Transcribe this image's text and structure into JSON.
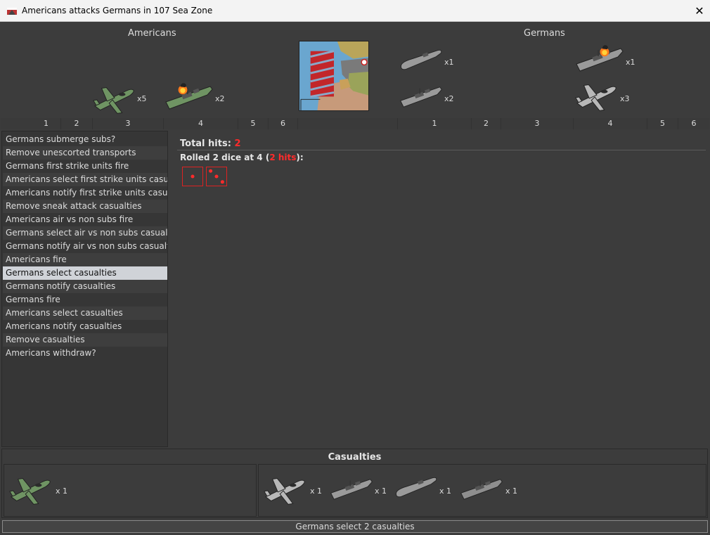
{
  "window": {
    "title": "Americans attacks Germans in 107 Sea Zone",
    "close_label": "✕"
  },
  "attacker": {
    "name": "Americans",
    "units": [
      {
        "icon": "fighter-plane-green-icon",
        "count": "x5"
      },
      {
        "icon": "damaged-battleship-green-icon",
        "count": "x2"
      }
    ],
    "dice_columns": [
      "1",
      "2",
      "3",
      "4",
      "5",
      "6"
    ]
  },
  "defender": {
    "name": "Germans",
    "units": [
      {
        "icon": "submarine-gray-icon",
        "count": "x1"
      },
      {
        "icon": "damaged-battleship-gray-icon",
        "count": "x1"
      },
      {
        "icon": "destroyer-gray-icon",
        "count": "x2"
      },
      {
        "icon": "fighter-plane-gray-icon",
        "count": "x3"
      }
    ],
    "dice_columns": [
      "1",
      "2",
      "3",
      "4",
      "5",
      "6"
    ]
  },
  "steps": [
    "Germans submerge subs?",
    "Remove unescorted transports",
    "Germans first strike units fire",
    "Americans select first strike units casualties",
    "Americans notify first strike units casualties",
    "Remove sneak attack casualties",
    "Americans air vs non subs fire",
    "Germans select air vs non subs casualties",
    "Germans notify air vs non subs casualties",
    "Americans fire",
    "Germans select casualties",
    "Germans notify casualties",
    "Germans fire",
    "Americans select casualties",
    "Americans notify casualties",
    "Remove casualties",
    "Americans withdraw?"
  ],
  "selected_step": 10,
  "results": {
    "total_hits_label": "Total hits:",
    "total_hits_value": "2",
    "rolled_prefix": "Rolled 2 dice at 4 (",
    "rolled_hits": "2 hits",
    "rolled_suffix": "):",
    "dice": [
      1,
      3
    ]
  },
  "casualties": {
    "title": "Casualties",
    "attacker": [
      {
        "icon": "fighter-plane-green-icon",
        "count": "x 1"
      }
    ],
    "defender": [
      {
        "icon": "fighter-plane-gray-icon",
        "count": "x 1"
      },
      {
        "icon": "destroyer-gray-icon",
        "count": "x 1"
      },
      {
        "icon": "submarine-gray-icon",
        "count": "x 1"
      },
      {
        "icon": "camouflaged-cruiser-icon",
        "count": "x 1"
      }
    ]
  },
  "status": "Germans select 2 casualties",
  "colors": {
    "hit": "#ff2b2b",
    "selected_step": "#d0d3d8",
    "us_unit": "#6f9463",
    "de_unit": "#9a9a9a"
  }
}
